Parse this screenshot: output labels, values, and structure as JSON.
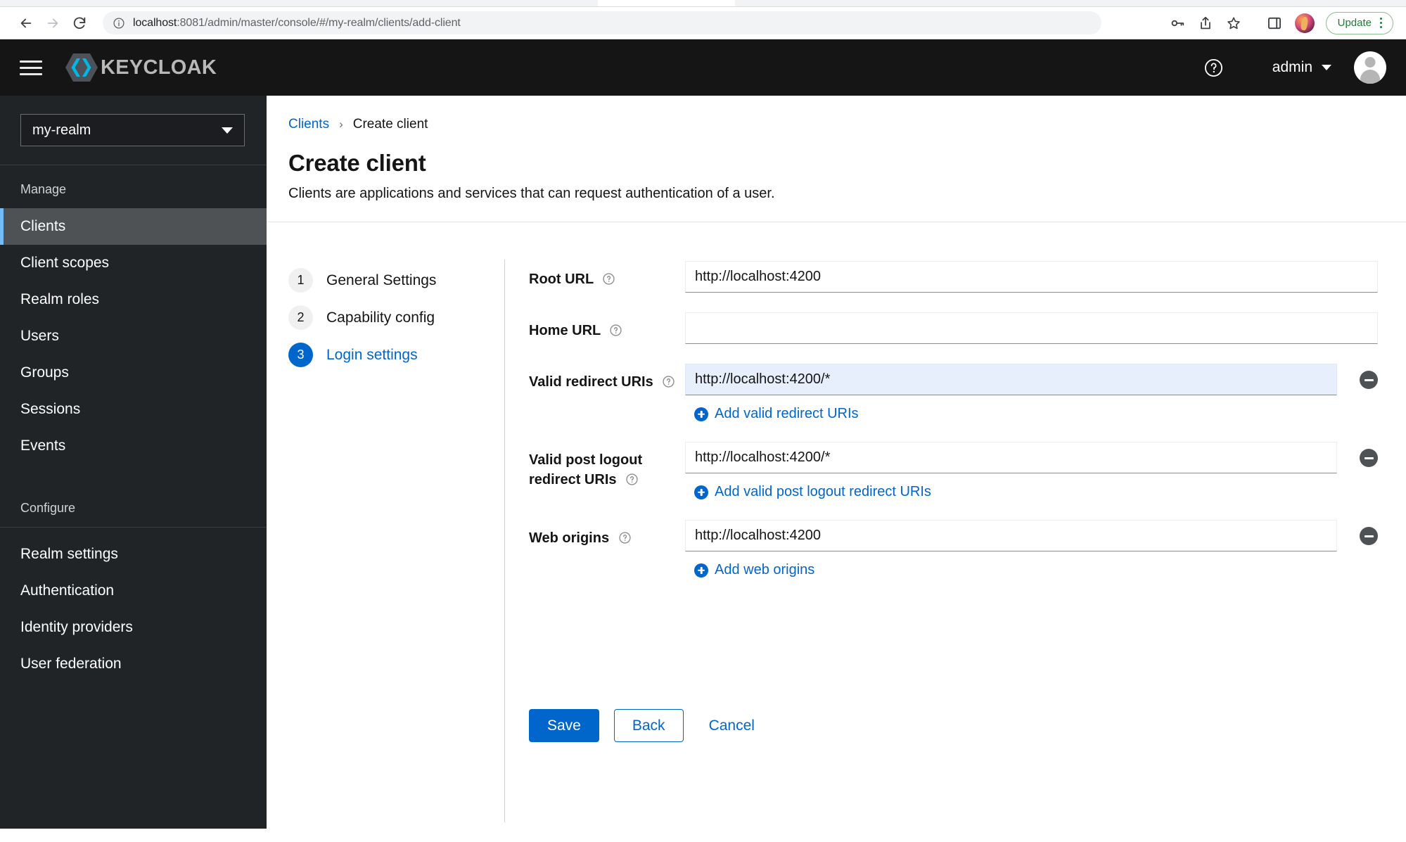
{
  "browser": {
    "url_host": "localhost",
    "url_path": ":8081/admin/master/console/#/my-realm/clients/add-client",
    "back_icon": "back-arrow-icon",
    "forward_icon": "forward-arrow-icon",
    "reload_icon": "reload-icon",
    "site_info_icon": "info-circle-icon",
    "password_icon": "key-icon",
    "share_icon": "share-icon",
    "bookmark_icon": "star-icon",
    "side_panel_icon": "side-panel-icon",
    "profile_icon": "profile-avatar-icon",
    "update_label": "Update",
    "menu_icon": "kebab-menu-icon"
  },
  "masthead": {
    "menu_icon": "hamburger-menu-icon",
    "brand": "KEYCLOAK",
    "brand_icon": "keycloak-logo-icon",
    "help_icon": "help-circle-icon",
    "user_name": "admin",
    "caret_icon": "chevron-down-icon",
    "avatar_icon": "user-avatar-icon"
  },
  "sidebar": {
    "realm_value": "my-realm",
    "realm_caret_icon": "caret-down-icon",
    "sections": [
      {
        "label": "Manage",
        "items": [
          {
            "label": "Clients",
            "active": true
          },
          {
            "label": "Client scopes",
            "active": false
          },
          {
            "label": "Realm roles",
            "active": false
          },
          {
            "label": "Users",
            "active": false
          },
          {
            "label": "Groups",
            "active": false
          },
          {
            "label": "Sessions",
            "active": false
          },
          {
            "label": "Events",
            "active": false
          }
        ]
      },
      {
        "label": "Configure",
        "items": [
          {
            "label": "Realm settings",
            "active": false
          },
          {
            "label": "Authentication",
            "active": false
          },
          {
            "label": "Identity providers",
            "active": false
          },
          {
            "label": "User federation",
            "active": false
          }
        ]
      }
    ]
  },
  "page": {
    "breadcrumb_parent": "Clients",
    "breadcrumb_separator": "›",
    "breadcrumb_current": "Create client",
    "title": "Create client",
    "subtitle": "Clients are applications and services that can request authentication of a user."
  },
  "wizard": {
    "steps": [
      {
        "number": "1",
        "label": "General Settings",
        "current": false
      },
      {
        "number": "2",
        "label": "Capability config",
        "current": false
      },
      {
        "number": "3",
        "label": "Login settings",
        "current": true
      }
    ]
  },
  "form": {
    "fields": [
      {
        "label": "Root URL",
        "help_icon": "help-circle-icon",
        "value": "http://localhost:4200",
        "placeholder": "",
        "highlighted": false,
        "has_remove": false,
        "add_label": null
      },
      {
        "label": "Home URL",
        "help_icon": "help-circle-icon",
        "value": "",
        "placeholder": "",
        "highlighted": false,
        "has_remove": false,
        "add_label": null
      },
      {
        "label": "Valid redirect URIs",
        "help_icon": "help-circle-icon",
        "value": "http://localhost:4200/*",
        "placeholder": "",
        "highlighted": true,
        "has_remove": true,
        "add_label": "Add valid redirect URIs"
      },
      {
        "label": "Valid post logout redirect URIs",
        "help_icon": "help-circle-icon",
        "value": "http://localhost:4200/*",
        "placeholder": "",
        "highlighted": false,
        "has_remove": true,
        "add_label": "Add valid post logout redirect URIs"
      },
      {
        "label": "Web origins",
        "help_icon": "help-circle-icon",
        "value": "http://localhost:4200",
        "placeholder": "",
        "highlighted": false,
        "has_remove": true,
        "add_label": "Add web origins"
      }
    ],
    "actions": {
      "save": "Save",
      "back": "Back",
      "cancel": "Cancel"
    }
  },
  "colors": {
    "accent_blue": "#0066CC",
    "masthead_black": "#151515",
    "sidebar_dark": "#212427",
    "sidebar_active": "#4F5255",
    "active_border": "#73BCF7",
    "input_highlight": "#E7EFFC",
    "update_green": "#1E7E34"
  }
}
